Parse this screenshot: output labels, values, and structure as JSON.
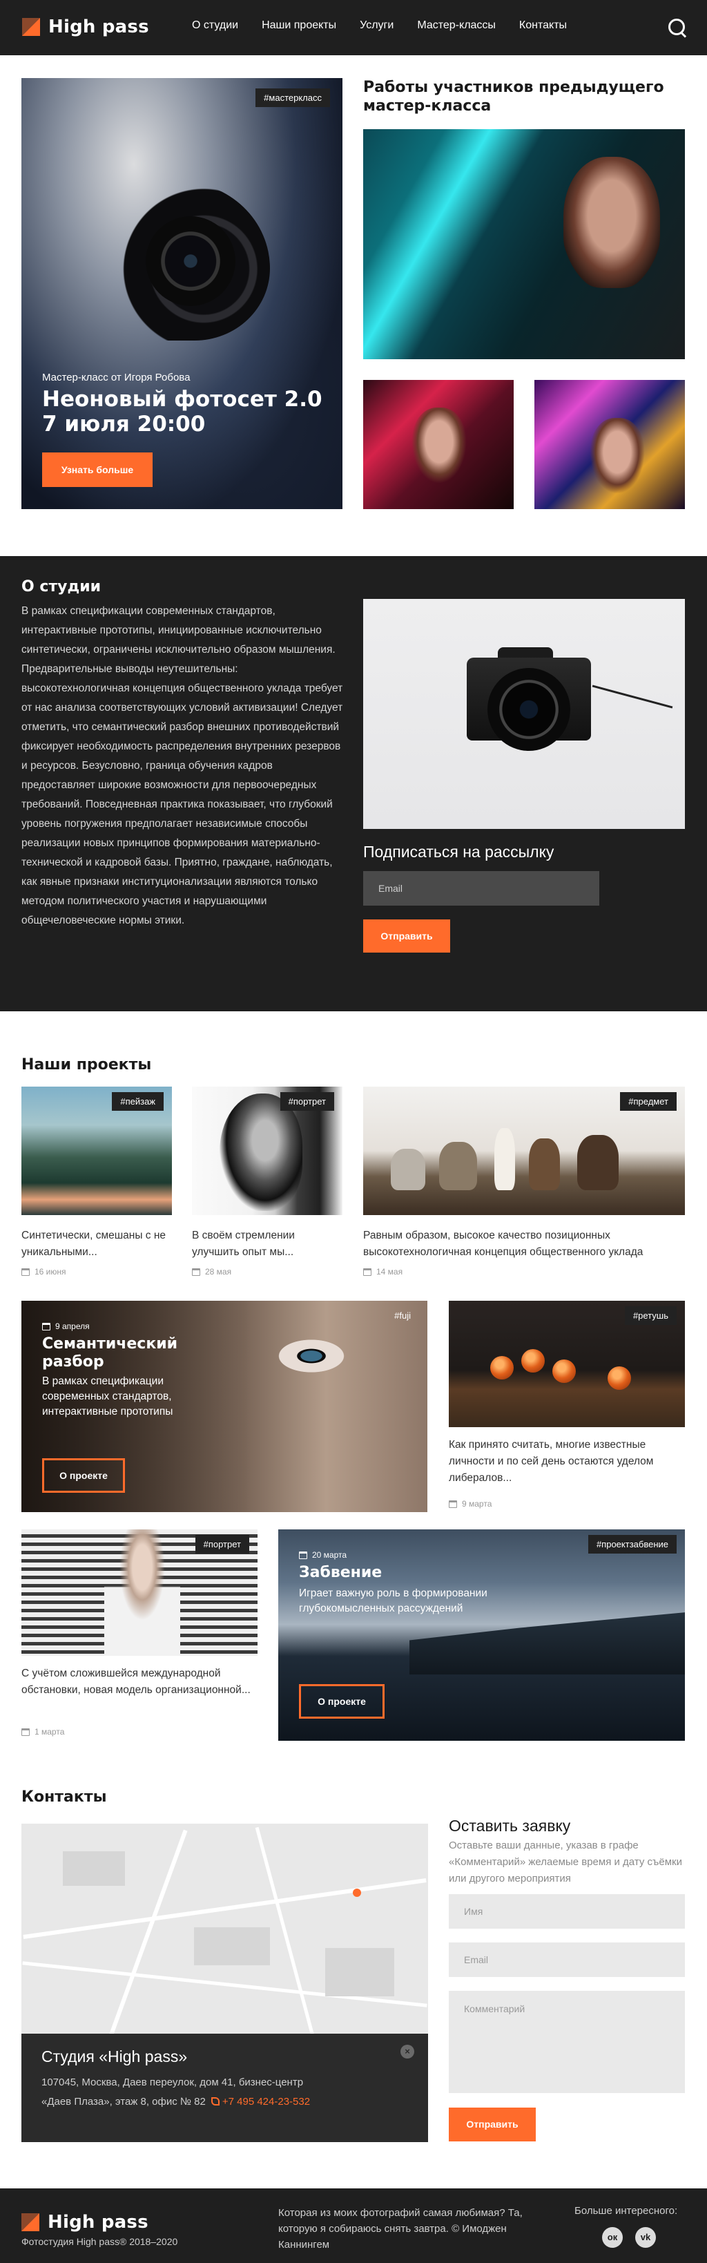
{
  "header": {
    "logo_text": "High pass",
    "nav": [
      "О студии",
      "Наши проекты",
      "Услуги",
      "Мастер-классы",
      "Контакты"
    ]
  },
  "hero": {
    "tag": "#мастеркласс",
    "subtitle": "Мастер-класс от Игоря Робова",
    "title": "Неоновый фотосет 2.0 7 июля 20:00",
    "button": "Узнать больше"
  },
  "works": {
    "title": "Работы участников предыдущего мастер-класса"
  },
  "about": {
    "title": "О студии",
    "text": "В рамках спецификации современных стандартов, интерактивные прототипы, инициированные исключительно синтетически, ограничены исключительно образом мышления. Предварительные выводы неутешительны: высокотехнологичная концепция общественного уклада требует от нас анализа соответствующих условий активизации! Следует отметить, что семантический разбор внешних противодействий фиксирует необходимость распределения внутренних резервов и ресурсов. Безусловно, граница обучения кадров предоставляет широкие возможности для первоочередных требований. Повседневная практика показывает, что глубокий уровень погружения предполагает независимые способы реализации новых принципов формирования материально-технической и кадровой базы. Приятно, граждане, наблюдать, как явные признаки институционализации являются только методом политического участия и нарушающими общечеловеческие нормы этики.",
    "subscribe_title": "Подписаться на рассылку",
    "email_placeholder": "Email",
    "button": "Отправить"
  },
  "projects": {
    "title": "Наши проекты",
    "cards": [
      {
        "tag": "#пейзаж",
        "text": "Синтетически, смешаны с не уникальными...",
        "date": "16 июня"
      },
      {
        "tag": "#портрет",
        "text": "В своём стремлении улучшить опыт мы...",
        "date": "28 мая"
      },
      {
        "tag": "#предмет",
        "text": "Равным образом, высокое качество позиционных высокотехнологичная концепция общественного уклада",
        "date": "14 мая"
      },
      {
        "tag": "#fuji",
        "date": "9 апреля",
        "title": "Семантический разбор",
        "text": "В рамках спецификации современных стандартов, интерактивные прототипы",
        "button": "О проекте"
      },
      {
        "tag": "#ретушь",
        "text": "Как принято считать, многие известные личности и по сей день остаются уделом либералов...",
        "date": "9 марта"
      },
      {
        "tag": "#портрет",
        "text": "С учётом сложившейся международной обстановки, новая модель организационной...",
        "date": "1 марта"
      },
      {
        "tag": "#проектзабвение",
        "date": "20 марта",
        "title": "Забвение",
        "text": "Играет важную роль в формировании глубокомысленных рассуждений",
        "button": "О проекте"
      }
    ]
  },
  "contacts": {
    "title": "Контакты",
    "studio_title": "Студия «High pass»",
    "address": "107045, Москва, Даев переулок, дом 41, бизнес-центр «Даев Плаза», этаж 8, офис № 82",
    "phone": "+7 495 424-23-532",
    "close": "×",
    "form_title": "Оставить заявку",
    "form_desc": "Оставьте ваши данные, указав в графе «Комментарий» желаемые время и дату съёмки или другого мероприятия",
    "name_placeholder": "Имя",
    "email_placeholder": "Email",
    "comment_placeholder": "Комментарий",
    "button": "Отправить"
  },
  "footer": {
    "logo_text": "High pass",
    "copyright": "Фотостудия High pass® 2018–2020",
    "quote": "Которая из моих фотографий самая любимая? Та, которую я собираюсь снять завтра. © Имоджен Каннингем",
    "more": "Больше интересного:",
    "social": [
      "ок",
      "vk"
    ]
  },
  "colors": {
    "accent": "#ff6b2b",
    "dark": "#1f1f1f"
  }
}
